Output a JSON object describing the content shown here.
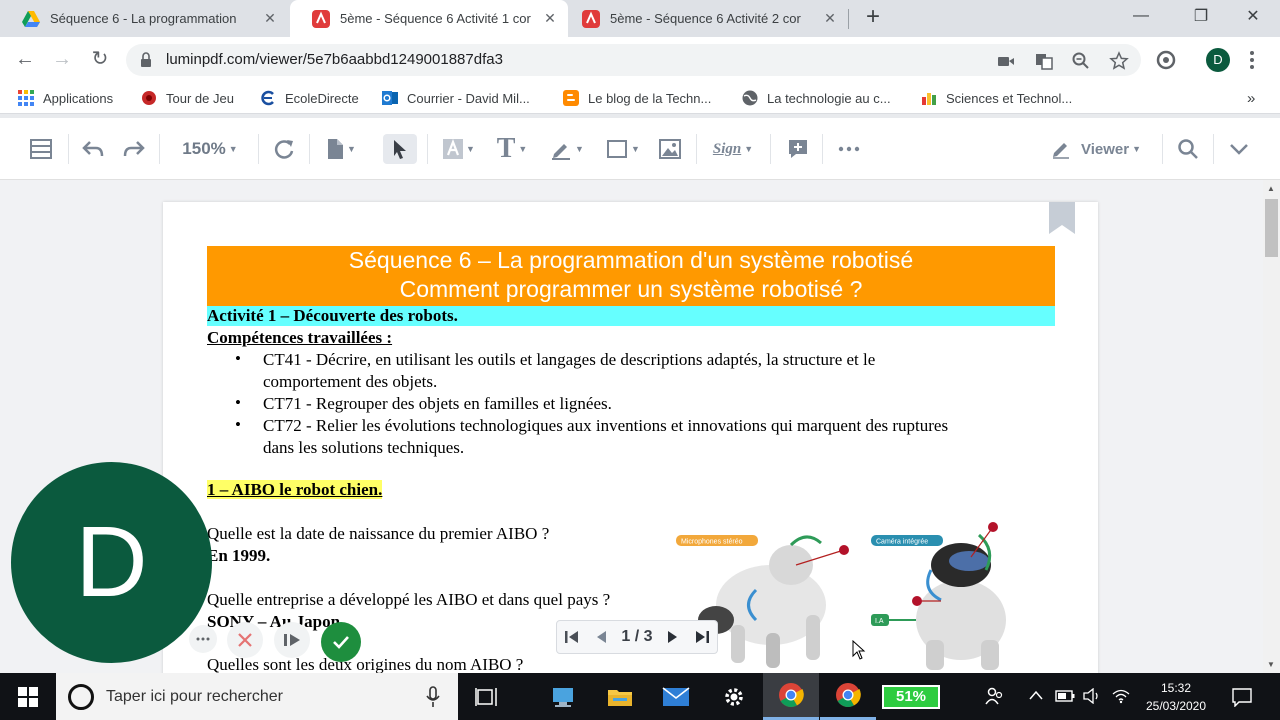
{
  "browser": {
    "tabs": [
      {
        "title": "Séquence 6 - La programmation",
        "icon": "google-drive-icon"
      },
      {
        "title": "5ème - Séquence 6 Activité 1 cor",
        "icon": "lumin-pdf-icon"
      },
      {
        "title": "5ème - Séquence 6 Activité 2 cor",
        "icon": "lumin-pdf-icon"
      }
    ],
    "url": "luminpdf.com/viewer/5e7b6aabbd1249001887dfa3",
    "profile_initial": "D",
    "bookmarks": [
      {
        "label": "Applications",
        "icon": "apps-grid-icon"
      },
      {
        "label": "Tour de Jeu",
        "icon": "tour-de-jeu-icon"
      },
      {
        "label": "EcoleDirecte",
        "icon": "ecoledirecte-icon"
      },
      {
        "label": "Courrier - David Mil...",
        "icon": "outlook-icon"
      },
      {
        "label": "Le blog de la Techn...",
        "icon": "blogger-icon"
      },
      {
        "label": "La technologie au c...",
        "icon": "globe-icon"
      },
      {
        "label": "Sciences et Technol...",
        "icon": "sciences-icon"
      }
    ]
  },
  "toolbar": {
    "zoom": "150%",
    "mode": "Viewer",
    "sign_label": "Sign"
  },
  "document": {
    "banner_line1": "Séquence 6 – La programmation d'un système robotisé",
    "banner_line2": "Comment programmer un système robotisé ?",
    "activity_title": "Activité 1 – Découverte des robots.",
    "skills_heading": "Compétences travaillées :",
    "skills": [
      {
        "line1": "CT41 - Décrire, en utilisant les outils et langages de descriptions adaptés, la structure et le",
        "line2": "comportement des objets."
      },
      {
        "line1": "CT71 - Regrouper des objets en familles et lignées.",
        "line2": ""
      },
      {
        "line1": "CT72 - Relier les évolutions technologiques aux inventions et innovations qui marquent des ruptures",
        "line2": "dans les solutions techniques."
      }
    ],
    "section1_title": "1 – AIBO le robot chien.",
    "q1": "Quelle est la date de naissance du premier AIBO ?",
    "a1": "En 1999.",
    "q2": "Quelle entreprise a développé les AIBO et dans quel pays ?",
    "a2": "SONY – Au Japon.",
    "q3": "Quelles sont les deux origines du nom AIBO ?",
    "figure_labels": {
      "microphones": "Microphones stéréo",
      "camera": "Caméra intégrée"
    }
  },
  "pagenav": {
    "current": "1",
    "total": "3",
    "display": "1 / 3"
  },
  "meet": {
    "initial": "D"
  },
  "taskbar": {
    "search_placeholder": "Taper ici pour rechercher",
    "battery": "51%",
    "time": "15:32",
    "date": "25/03/2020"
  }
}
